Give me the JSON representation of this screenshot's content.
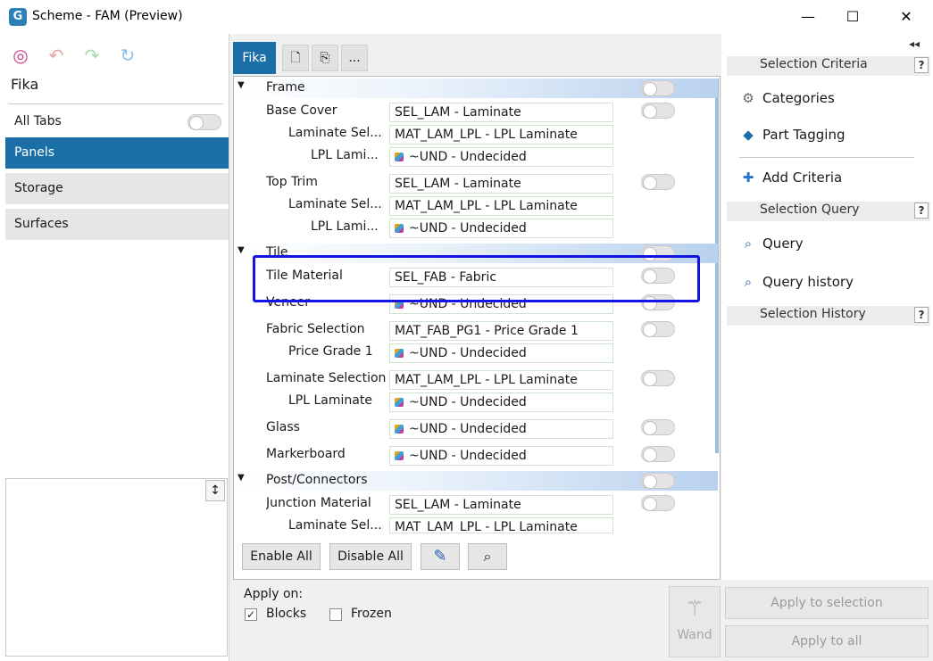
{
  "window": {
    "title": "Scheme - FAM (Preview)",
    "app_icon": "app-logo-icon",
    "controls": {
      "minimize": "—",
      "maximize": "☐",
      "close": "✕"
    }
  },
  "left": {
    "scheme_name": "Fika",
    "all_tabs_label": "All Tabs",
    "nav": [
      "Panels",
      "Storage",
      "Surfaces"
    ],
    "notes_button": "↕"
  },
  "tabs": {
    "active": "Fika",
    "more": "..."
  },
  "grid": {
    "groups": {
      "frame": "Frame",
      "tile": "Tile",
      "post": "Post/Connectors"
    },
    "rows": {
      "base_cover": {
        "label": "Base Cover",
        "value": "SEL_LAM - Laminate"
      },
      "base_lam_sel": {
        "label": "Laminate Sel...",
        "value": "MAT_LAM_LPL - LPL Laminate"
      },
      "base_lpl": {
        "label": "LPL Lami...",
        "value": "~UND - Undecided"
      },
      "top_trim": {
        "label": "Top Trim",
        "value": "SEL_LAM - Laminate"
      },
      "top_lam_sel": {
        "label": "Laminate Sel...",
        "value": "MAT_LAM_LPL - LPL Laminate"
      },
      "top_lpl": {
        "label": "LPL Lami...",
        "value": "~UND - Undecided"
      },
      "tile_material": {
        "label": "Tile Material",
        "value": "SEL_FAB - Fabric"
      },
      "veneer": {
        "label": "Veneer",
        "value": "~UND - Undecided"
      },
      "fabric_sel": {
        "label": "Fabric Selection",
        "value": "MAT_FAB_PG1 - Price Grade 1"
      },
      "price_grade": {
        "label": "Price Grade 1",
        "value": "~UND - Undecided"
      },
      "lam_sel": {
        "label": "Laminate Selection",
        "value": "MAT_LAM_LPL - LPL Laminate"
      },
      "lpl_lam": {
        "label": "LPL Laminate",
        "value": "~UND - Undecided"
      },
      "glass": {
        "label": "Glass",
        "value": "~UND - Undecided"
      },
      "markerboard": {
        "label": "Markerboard",
        "value": "~UND - Undecided"
      },
      "junction": {
        "label": "Junction Material",
        "value": "SEL_LAM - Laminate"
      },
      "junc_lam_sel": {
        "label": "Laminate Sel...",
        "value": "MAT_LAM_LPL - LPL Laminate"
      }
    }
  },
  "bottom": {
    "enable_all": "Enable All",
    "disable_all": "Disable All",
    "apply_on": "Apply on:",
    "blocks": "Blocks",
    "frozen": "Frozen",
    "wand": "Wand",
    "apply_selection": "Apply to selection",
    "apply_all": "Apply to all"
  },
  "right": {
    "collapse": "◂◂",
    "selection_criteria": "Selection Criteria",
    "categories": "Categories",
    "part_tagging": "Part Tagging",
    "add_criteria": "Add Criteria",
    "selection_query": "Selection Query",
    "query": "Query",
    "query_history": "Query history",
    "selection_history": "Selection History",
    "help": "?"
  },
  "colors": {
    "accent": "#1b6fa8",
    "highlight": "#1414e0"
  }
}
